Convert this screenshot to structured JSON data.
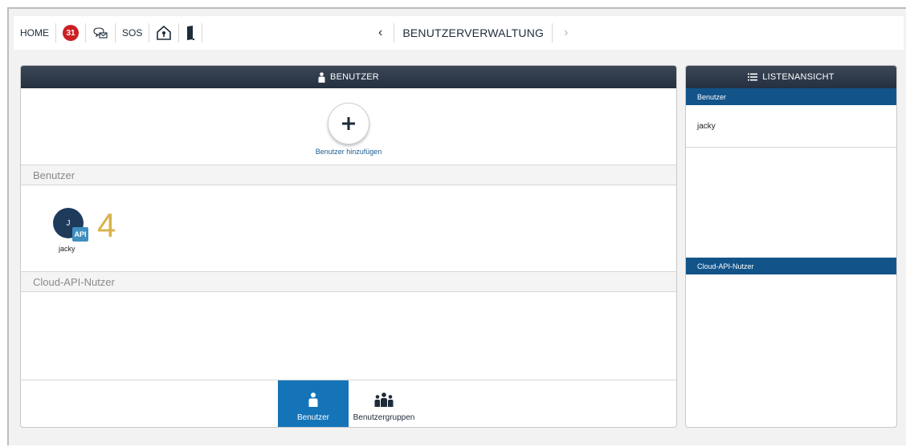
{
  "topbar": {
    "home_label": "HOME",
    "notification_count": "31",
    "sos_label": "SOS",
    "title": "BENUTZERVERWALTUNG"
  },
  "main": {
    "header": "BENUTZER",
    "add_label": "Benutzer hinzufügen",
    "sections": {
      "users": "Benutzer",
      "cloud_api": "Cloud-API-Nutzer"
    },
    "user": {
      "initial": "J",
      "tag": "API",
      "name": "jacky"
    },
    "user_count": "4",
    "tabs": [
      {
        "label": "Benutzer",
        "active": true
      },
      {
        "label": "Benutzergruppen",
        "active": false
      }
    ]
  },
  "side": {
    "header": "LISTENANSICHT",
    "groups": [
      {
        "title": "Benutzer",
        "items": [
          "jacky"
        ]
      },
      {
        "title": "Cloud-API-Nutzer",
        "items": []
      }
    ]
  },
  "colors": {
    "header_bg": "#2c3848",
    "accent_blue": "#1574b8",
    "list_sub_blue": "#12548a",
    "badge_red": "#cc1f25",
    "count_gold": "#d8b24a"
  }
}
